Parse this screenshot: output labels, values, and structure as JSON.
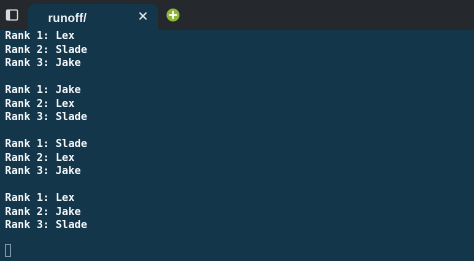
{
  "tab": {
    "title": "runoff/"
  },
  "icons": {
    "panel": "panel-toggle-icon",
    "close": "close-icon",
    "add": "plus-icon"
  },
  "colors": {
    "terminal_bg": "#13364a",
    "tabbar_bg": "#25282c",
    "text": "#f4f6f8",
    "add_button": "#8fb43a"
  },
  "terminal": {
    "blocks": [
      [
        "Rank 1: Lex",
        "Rank 2: Slade",
        "Rank 3: Jake"
      ],
      [
        "Rank 1: Jake",
        "Rank 2: Lex",
        "Rank 3: Slade"
      ],
      [
        "Rank 1: Slade",
        "Rank 2: Lex",
        "Rank 3: Jake"
      ],
      [
        "Rank 1: Lex",
        "Rank 2: Jake",
        "Rank 3: Slade"
      ]
    ]
  }
}
